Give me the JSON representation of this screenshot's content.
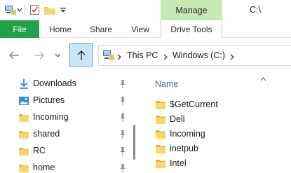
{
  "window": {
    "title": "C:\\",
    "contextual_tab_group": "Manage"
  },
  "ribbon": {
    "tabs": [
      {
        "label": "File"
      },
      {
        "label": "Home"
      },
      {
        "label": "Share"
      },
      {
        "label": "View"
      },
      {
        "label": "Drive Tools"
      }
    ]
  },
  "address": {
    "crumbs": [
      "This PC",
      "Windows (C:)"
    ]
  },
  "sidebar": {
    "items": [
      {
        "label": "Downloads",
        "icon": "download-icon",
        "pinned": true
      },
      {
        "label": "Pictures",
        "icon": "pictures-icon",
        "pinned": true
      },
      {
        "label": "Incoming",
        "icon": "folder-icon",
        "pinned": true
      },
      {
        "label": "shared",
        "icon": "folder-icon",
        "pinned": true
      },
      {
        "label": "RC",
        "icon": "folder-icon",
        "pinned": true
      },
      {
        "label": "home",
        "icon": "folder-icon",
        "pinned": true
      }
    ]
  },
  "content": {
    "column_header": "Name",
    "files": [
      {
        "name": "$GetCurrent",
        "icon": "folder-icon"
      },
      {
        "name": "Dell",
        "icon": "folder-icon"
      },
      {
        "name": "Incoming",
        "icon": "folder-icon"
      },
      {
        "name": "inetpub",
        "icon": "folder-icon"
      },
      {
        "name": "Intel",
        "icon": "folder-icon"
      }
    ]
  },
  "colors": {
    "accent": "#22a04b",
    "manage_tab": "#c6e8b4",
    "up_button": "#cde6f7",
    "folder": "#f2c14e"
  }
}
